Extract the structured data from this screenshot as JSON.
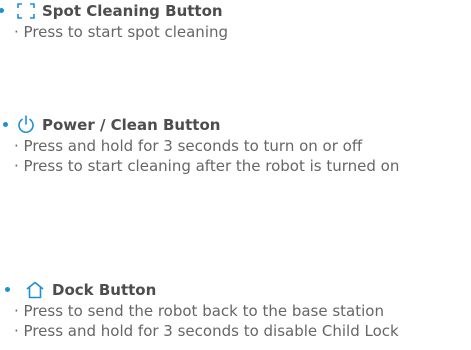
{
  "accent_color": "#1f8fd6",
  "sections": [
    {
      "icon": "spot-cleaning-icon",
      "title": "Spot Cleaning Button",
      "items": [
        "· Press to start spot cleaning"
      ]
    },
    {
      "icon": "power-icon",
      "title": "Power / Clean Button",
      "items": [
        "· Press and hold for 3 seconds to turn on or off",
        "· Press to start cleaning after the robot is turned on"
      ]
    },
    {
      "icon": "home-icon",
      "title": "Dock Button",
      "items": [
        "· Press to send the robot back to the base station",
        "· Press and hold for 3 seconds to disable Child Lock"
      ]
    }
  ]
}
